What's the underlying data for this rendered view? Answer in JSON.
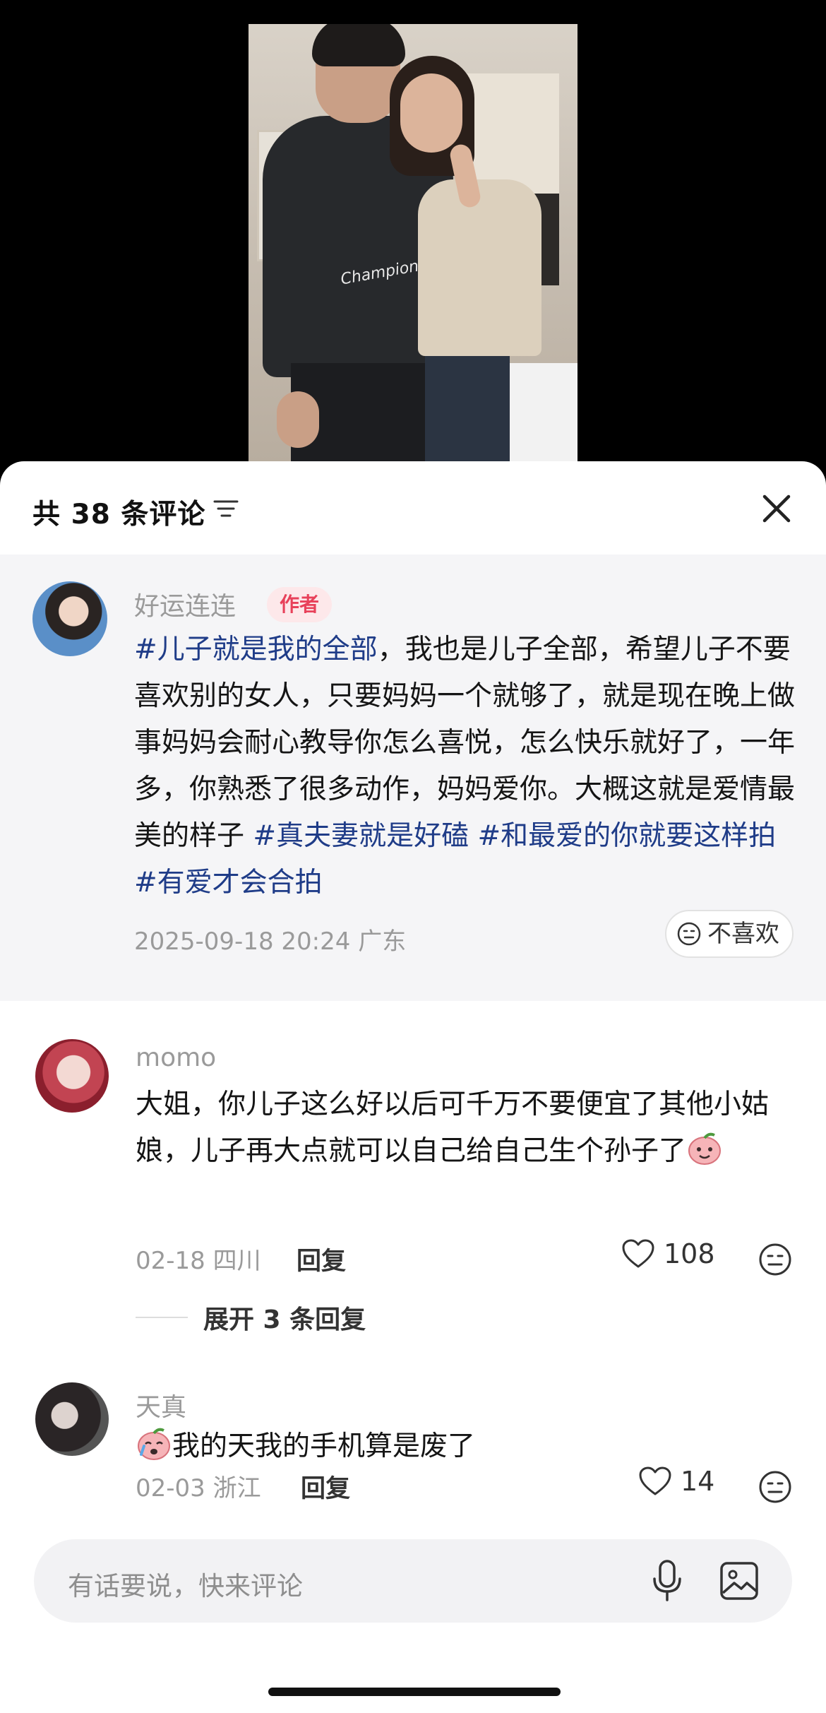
{
  "header": {
    "comment_count_label": "共 38 条评论"
  },
  "author_comment": {
    "username": "好运连连",
    "badge": "作者",
    "text_parts": [
      {
        "type": "tag",
        "text": "#儿子就是我的全部"
      },
      {
        "type": "text",
        "text": "，我也是儿子全部，希望儿子不要喜欢别的女人，只要妈妈一个就够了，就是现在晚上做事妈妈会耐心教导你怎么喜悦，怎么快乐就好了，一年多，你熟悉了很多动作，妈妈爱你。大概这就是爱情最美的样子 "
      },
      {
        "type": "tag",
        "text": "#真夫妻就是好磕"
      },
      {
        "type": "text",
        "text": " "
      },
      {
        "type": "tag",
        "text": "#和最爱的你就要这样拍"
      },
      {
        "type": "text",
        "text": " "
      },
      {
        "type": "tag",
        "text": "#有爱才会合拍"
      }
    ],
    "meta": "2025-09-18 20:24 广东",
    "dislike_label": "不喜欢"
  },
  "comments": [
    {
      "username": "momo",
      "text": "大姐，你儿子这么好以后可千万不要便宜了其他小姑娘，儿子再大点就可以自己给自己生个孙子了",
      "meta": "02-18 四川",
      "reply_label": "回复",
      "likes": "108",
      "expand_label": "展开 3 条回复"
    },
    {
      "username": "天真",
      "text": "我的天我的手机算是废了",
      "meta": "02-03 浙江",
      "reply_label": "回复",
      "likes": "14"
    }
  ],
  "input": {
    "placeholder": "有话要说，快来评论"
  },
  "colors": {
    "tag": "#1f3c88",
    "badge_bg": "#fde8ea",
    "badge_text": "#e8415a",
    "author_bg": "#f5f5f7"
  }
}
